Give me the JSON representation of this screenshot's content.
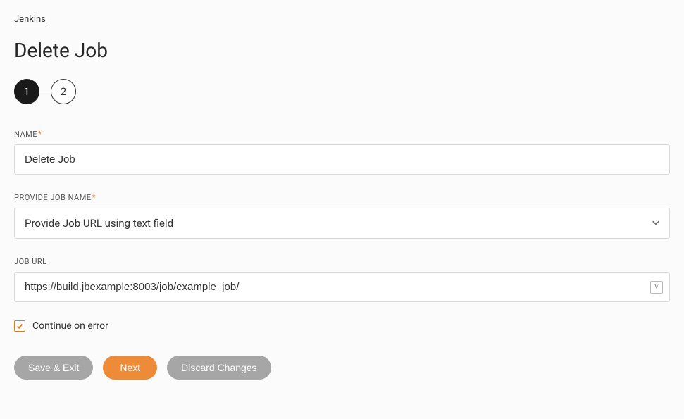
{
  "breadcrumb": {
    "label": "Jenkins"
  },
  "page_title": "Delete Job",
  "steps": {
    "one": "1",
    "two": "2"
  },
  "form": {
    "name": {
      "label": "NAME",
      "value": "Delete Job"
    },
    "provide_job_name": {
      "label": "PROVIDE JOB NAME",
      "selected": "Provide Job URL using text field"
    },
    "job_url": {
      "label": "JOB URL",
      "value": "https://build.jbexample:8003/job/example_job/",
      "badge": "V"
    },
    "continue_on_error": {
      "label": "Continue on error",
      "checked": true
    }
  },
  "buttons": {
    "save_exit": "Save & Exit",
    "next": "Next",
    "discard": "Discard Changes"
  }
}
